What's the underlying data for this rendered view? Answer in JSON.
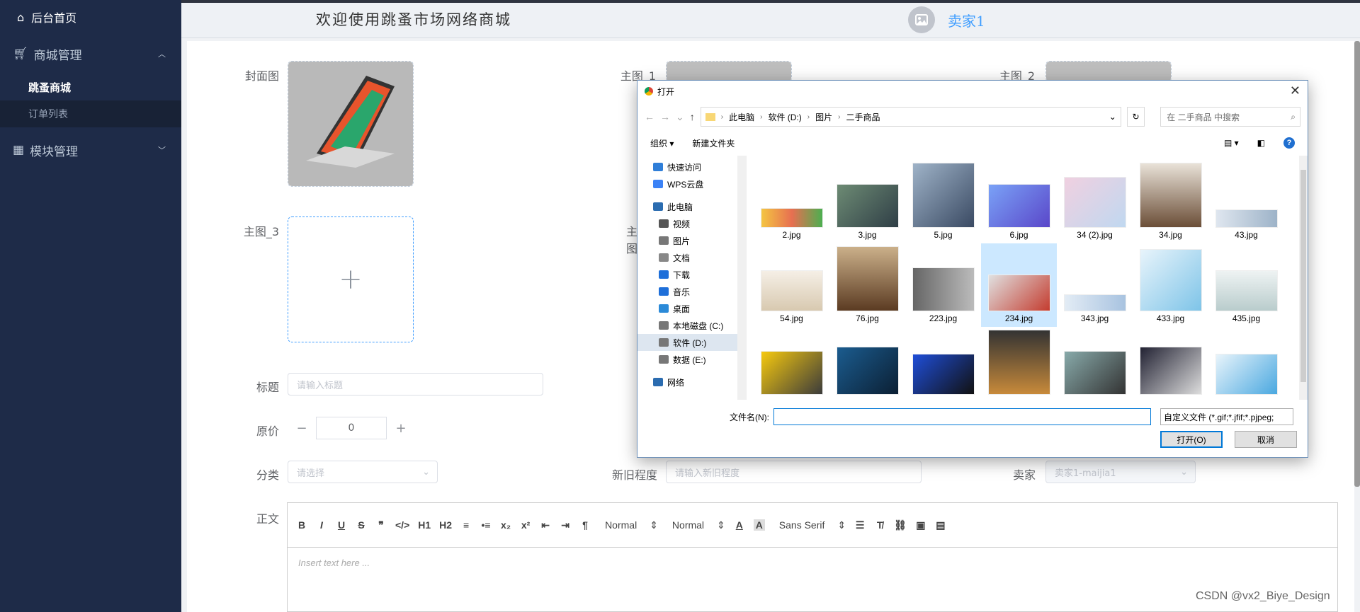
{
  "sidebar": {
    "home": "后台首页",
    "mall_group": "商城管理",
    "items": [
      {
        "label": "跳蚤商城"
      },
      {
        "label": "订单列表"
      }
    ],
    "module_group": "模块管理"
  },
  "header": {
    "welcome": "欢迎使用跳蚤市场网络商城",
    "user_name": "卖家1"
  },
  "form": {
    "cover_label": "封面图",
    "main1_label": "主图_1",
    "main2_label": "主图_2",
    "main3_label": "主图_3",
    "main4_label": "主图",
    "title_label": "标题",
    "title_placeholder": "请输入标题",
    "price_label": "原价",
    "price_value": "0",
    "price_minus": "−",
    "price_plus": "+",
    "category_label": "分类",
    "category_placeholder": "请选择",
    "condition_label": "新旧程度",
    "condition_placeholder": "请输入新旧程度",
    "seller_label": "卖家",
    "seller_value": "卖家1-maijia1",
    "body_label": "正文"
  },
  "editor": {
    "toolbar": [
      "B",
      "I",
      "U",
      "S",
      "❞",
      "</>",
      "H1",
      "H2",
      "≡",
      "•≡",
      "x₂",
      "x²",
      "⇤",
      "⇥",
      "¶"
    ],
    "header_select": "Normal",
    "size_select": "Normal",
    "font_select": "Sans Serif",
    "placeholder": "Insert text here ..."
  },
  "dialog": {
    "title": "打开",
    "close": "✕",
    "breadcrumb": [
      "此电脑",
      "软件 (D:)",
      "图片",
      "二手商品"
    ],
    "search_placeholder": "在 二手商品 中搜索",
    "organize": "组织 ▾",
    "new_folder": "新建文件夹",
    "help": "?",
    "nav": [
      {
        "label": "快速访问",
        "icon": "star-icon"
      },
      {
        "label": "WPS云盘",
        "icon": "cloud-icon"
      },
      {
        "label": "此电脑",
        "icon": "computer-icon"
      },
      {
        "label": "视频",
        "icon": "video-icon"
      },
      {
        "label": "图片",
        "icon": "picture-icon"
      },
      {
        "label": "文档",
        "icon": "document-icon"
      },
      {
        "label": "下载",
        "icon": "download-icon"
      },
      {
        "label": "音乐",
        "icon": "music-icon"
      },
      {
        "label": "桌面",
        "icon": "desktop-icon"
      },
      {
        "label": "本地磁盘 (C:)",
        "icon": "disk-icon"
      },
      {
        "label": "软件 (D:)",
        "icon": "disk-icon"
      },
      {
        "label": "数据 (E:)",
        "icon": "disk-icon"
      },
      {
        "label": "网络",
        "icon": "network-icon"
      }
    ],
    "files": [
      {
        "name": "2.jpg"
      },
      {
        "name": "3.jpg"
      },
      {
        "name": "5.jpg"
      },
      {
        "name": "6.jpg"
      },
      {
        "name": "34 (2).jpg"
      },
      {
        "name": "34.jpg"
      },
      {
        "name": "43.jpg"
      },
      {
        "name": "54.jpg"
      },
      {
        "name": "76.jpg"
      },
      {
        "name": "223.jpg"
      },
      {
        "name": "234.jpg"
      },
      {
        "name": "343.jpg"
      },
      {
        "name": "433.jpg"
      },
      {
        "name": "435.jpg"
      }
    ],
    "filename_label": "文件名(N):",
    "filetype": "自定义文件 (*.gif;*.jfif;*.pjpeg;",
    "open_button": "打开(O)",
    "cancel_button": "取消"
  },
  "watermark": "CSDN @vx2_Biye_Design"
}
